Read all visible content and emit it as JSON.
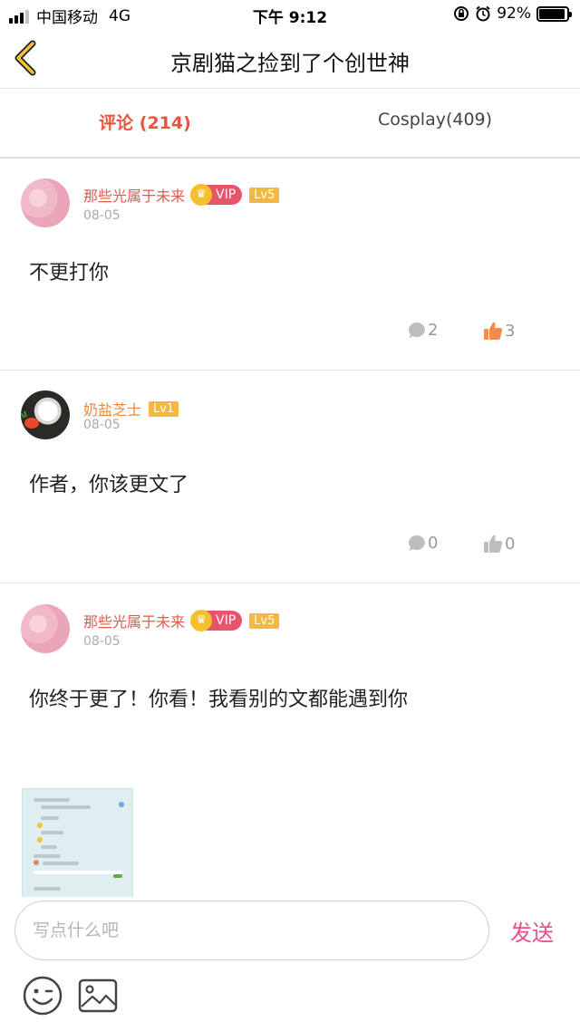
{
  "status_bar": {
    "carrier": "中国移动",
    "network": "4G",
    "time": "下午 9:12",
    "battery": "92%",
    "battery_level": 0.92
  },
  "nav": {
    "title": "京剧猫之捡到了个创世神"
  },
  "tabs": {
    "comments": "评论 (214)",
    "cosplay": "Cosplay(409)"
  },
  "comments": [
    {
      "username": "那些光属于未来",
      "vip": "VIP",
      "level": "Lv5",
      "date": "08-05",
      "text": "不更打你",
      "reply_count": "2",
      "like_count": "3",
      "liked": true
    },
    {
      "username": "奶盐芝士",
      "level": "Lv1",
      "date": "08-05",
      "text": "作者，你该更文了",
      "reply_count": "0",
      "like_count": "0",
      "liked": false
    },
    {
      "username": "那些光属于未来",
      "vip": "VIP",
      "level": "Lv5",
      "date": "08-05",
      "text": "你终于更了！你看！我看别的文都能遇到你"
    }
  ],
  "input": {
    "placeholder": "写点什么吧",
    "send": "发送"
  },
  "colors": {
    "accent_red": "#e8553e",
    "send_pink": "#ea4d89",
    "like_orange": "#f28b4e",
    "vip_red": "#e8556a",
    "level_gold": "#f4b73f"
  },
  "icons": [
    "back-chevron-icon",
    "reply-bubble-icon",
    "thumb-up-icon",
    "emoji-icon",
    "image-icon",
    "crown-icon",
    "alarm-icon",
    "lock-rotation-icon"
  ]
}
